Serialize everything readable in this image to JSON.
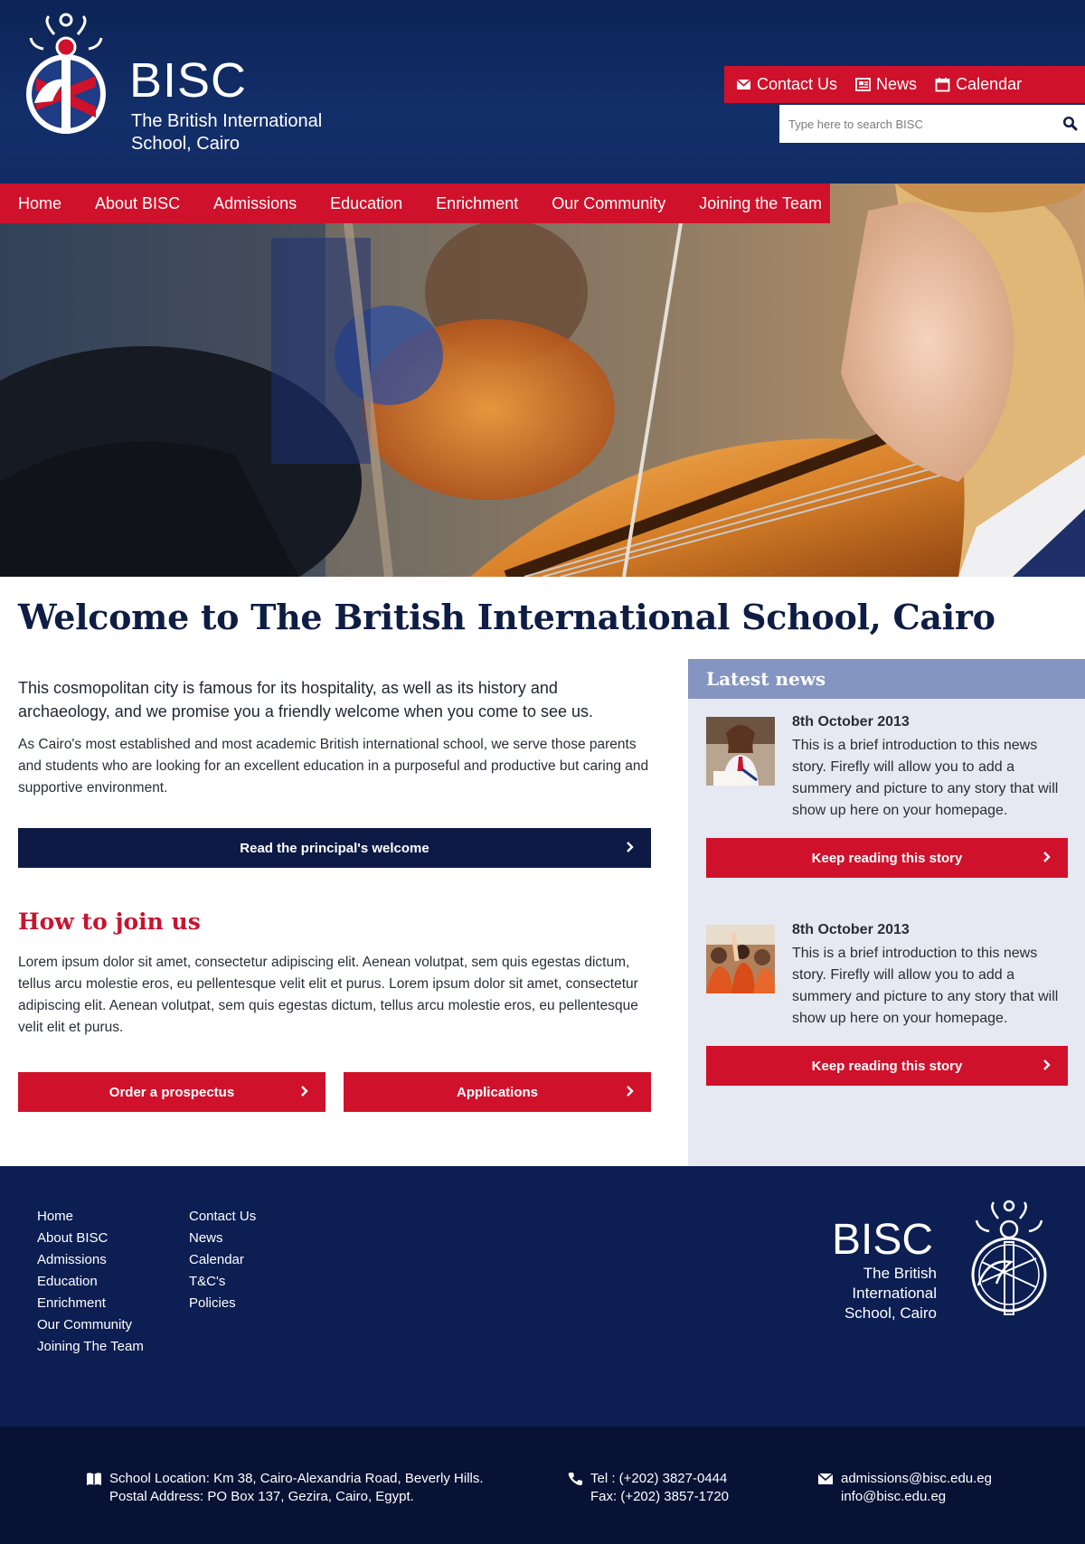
{
  "header": {
    "logo_name": "BISC",
    "logo_subtitle_line1": "The British International",
    "logo_subtitle_line2": "School, Cairo",
    "utility_links": {
      "contact": "Contact Us",
      "news": "News",
      "calendar": "Calendar"
    },
    "search": {
      "placeholder": "Type here to search BISC"
    }
  },
  "nav": {
    "home": "Home",
    "about": "About BISC",
    "admissions": "Admissions",
    "education": "Education",
    "enrichment": "Enrichment",
    "community": "Our Community",
    "joining": "Joining the Team"
  },
  "main": {
    "title": "Welcome to The British International School, Cairo",
    "lead": "This cosmopolitan city is famous for its hospitality, as well as its history and archaeology, and we promise you a friendly welcome when you come to see us.",
    "body": "As Cairo's most established and most academic British international school, we serve those parents and students who are looking for an excellent education in a purposeful and productive but caring and supportive environment.",
    "principal_button": "Read the principal's welcome",
    "join_title": "How to join us",
    "join_body": "Lorem ipsum dolor sit amet, consectetur adipiscing elit. Aenean volutpat, sem quis egestas dictum, tellus arcu molestie eros, eu pellentesque velit elit et purus. Lorem ipsum dolor sit amet, consectetur adipiscing elit. Aenean volutpat, sem quis egestas dictum, tellus arcu molestie eros, eu pellentesque velit elit et purus.",
    "prospectus_button": "Order a prospectus",
    "applications_button": "Applications"
  },
  "news": {
    "heading": "Latest news",
    "items": [
      {
        "date": "8th October 2013",
        "text": "This is a brief introduction to this news story. Firefly will allow you to add a summery and picture to any story that will show up here on your homepage.",
        "button": "Keep reading this story"
      },
      {
        "date": "8th October 2013",
        "text": "This is a brief introduction to this news story. Firefly will allow you to add a summery and picture to any story that will show up here on your homepage.",
        "button": "Keep reading this story"
      }
    ]
  },
  "footer": {
    "col1": [
      "Home",
      "About BISC",
      "Admissions",
      "Education",
      "Enrichment",
      "Our Community",
      "Joining The Team"
    ],
    "col2": [
      "Contact Us",
      "News",
      "Calendar",
      "T&C's",
      "Policies"
    ],
    "logo_name": "BISC",
    "logo_sub1": "The British",
    "logo_sub2": "International",
    "logo_sub3": "School, Cairo"
  },
  "contact": {
    "location": "School Location: Km 38, Cairo-Alexandria Road, Beverly Hills.",
    "postal": "Postal Address: PO Box 137, Gezira, Cairo, Egypt.",
    "tel": "Tel : (+202) 3827-0444",
    "fax": "Fax: (+202) 3857-1720",
    "email1": "admissions@bisc.edu.eg",
    "email2": "info@bisc.edu.eg"
  },
  "colors": {
    "navy": "#0c2456",
    "red": "#d0112b",
    "news_header": "#8595c1",
    "news_bg": "#e6e9f1"
  },
  "icons": [
    "envelope-icon",
    "newspaper-icon",
    "calendar-icon",
    "search-icon",
    "chevron-right-icon",
    "book-icon",
    "phone-icon"
  ]
}
